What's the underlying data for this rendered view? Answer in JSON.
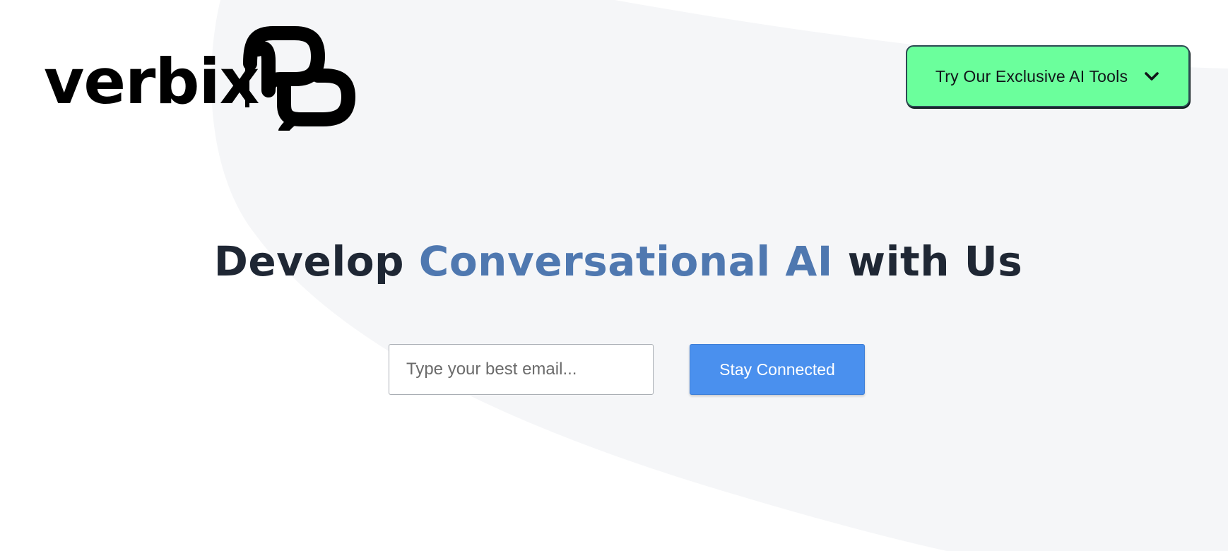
{
  "brand": {
    "name": "verbix",
    "icon": "speech-bubbles-logo-icon"
  },
  "header": {
    "tools_button_label": "Try Our Exclusive AI Tools",
    "tools_button_icon": "chevron-down-icon"
  },
  "hero": {
    "title_start": "Develop ",
    "title_accent": "Conversational AI",
    "title_end": " with Us"
  },
  "signup": {
    "email_placeholder": "Type your best email...",
    "submit_label": "Stay Connected"
  },
  "colors": {
    "background_shape": "#f5f6f8",
    "tools_button_bg": "#6bff9c",
    "accent_text": "#4f78b0",
    "primary_button": "#4a90ee",
    "title_text": "#1f2734"
  }
}
